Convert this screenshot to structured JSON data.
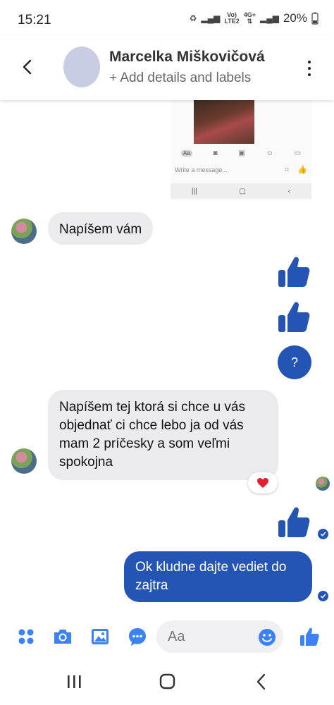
{
  "status": {
    "time": "15:21",
    "network_top": "Vo)",
    "network_bottom": "LTE2",
    "data_top": "4G+",
    "battery": "20%"
  },
  "header": {
    "name": "Marcelka Miškovičová",
    "subtitle": "+ Add details and labels"
  },
  "shared_screenshot": {
    "input_placeholder": "Write a message...",
    "tool_aa": "Aa"
  },
  "messages": [
    {
      "from": "contact",
      "text": "Napíšem vám"
    },
    {
      "from": "me",
      "type": "like"
    },
    {
      "from": "me",
      "type": "like"
    },
    {
      "from": "me",
      "text": "?"
    },
    {
      "from": "contact",
      "lines": [
        "Napíšem tej ktorá si chce u vás",
        "objednať ci chce lebo ja od vás",
        "mam 2 príčesky a som veľmi",
        "spokojna"
      ],
      "reaction": "heart"
    },
    {
      "from": "me",
      "type": "like"
    },
    {
      "from": "me",
      "lines": [
        "Ok kludne dajte vediet do",
        "zajtra"
      ]
    }
  ],
  "composer": {
    "placeholder": "Aa"
  },
  "colors": {
    "accent": "#2455b4",
    "incoming_bubble": "#ebebed",
    "icon_blue": "#3b82f6"
  }
}
